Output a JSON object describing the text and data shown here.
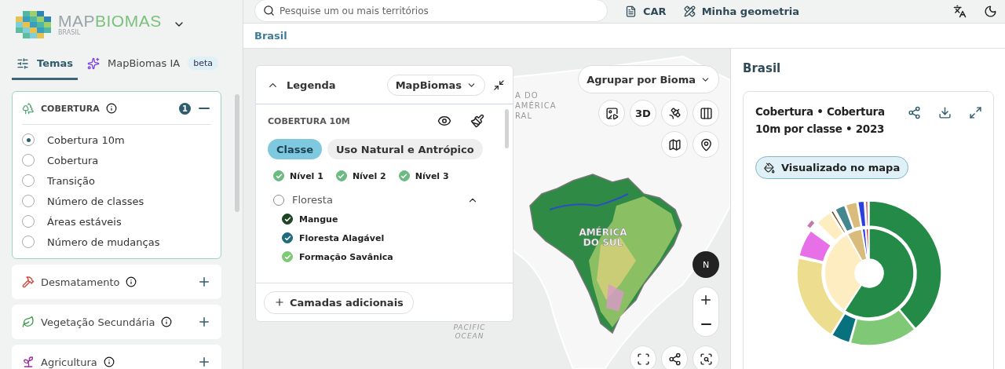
{
  "logo": {
    "text_1": "MAP",
    "text_2": "BIOMAS",
    "subtitle": "BRASIL"
  },
  "sidebar_tabs": [
    {
      "label": "Temas",
      "selected": true
    },
    {
      "label": "MapBiomas IA",
      "selected": false,
      "badge": "beta"
    }
  ],
  "themes": [
    {
      "title": "COBERTURA",
      "expanded": true,
      "count": "1",
      "color": "#5aa777",
      "options": [
        {
          "label": "Cobertura 10m",
          "selected": true
        },
        {
          "label": "Cobertura",
          "selected": false
        },
        {
          "label": "Transição",
          "selected": false
        },
        {
          "label": "Número de classes",
          "selected": false
        },
        {
          "label": "Áreas estáveis",
          "selected": false
        },
        {
          "label": "Número de mudanças",
          "selected": false
        }
      ]
    },
    {
      "title": "Desmatamento",
      "expanded": false,
      "color": "#d0453a"
    },
    {
      "title": "Vegetação Secundária",
      "expanded": false,
      "color": "#3c9a4a"
    },
    {
      "title": "Agricultura",
      "expanded": false,
      "color": "#9b2fa3"
    }
  ],
  "search": {
    "placeholder": "Pesquise um ou mais territórios"
  },
  "top_links": [
    "CAR",
    "Minha geometria"
  ],
  "breadcrumb": "Brasil",
  "legend": {
    "title": "Legenda",
    "expanded": true,
    "source": "MapBiomas",
    "section": "COBERTURA 10M",
    "modes": [
      {
        "label": "Classe",
        "selected": true
      },
      {
        "label": "Uso Natural e Antrópico",
        "selected": false
      }
    ],
    "levels": [
      {
        "label": "Nível 1",
        "checked": true
      },
      {
        "label": "Nível 2",
        "checked": true
      },
      {
        "label": "Nível 3",
        "checked": true
      }
    ],
    "group": {
      "label": "Floresta",
      "checked": false,
      "expanded": true,
      "children": [
        {
          "label": "Mangue",
          "checked": true,
          "color": "#1f4423"
        },
        {
          "label": "Floresta Alagável",
          "checked": true,
          "color": "#1e6b7e"
        },
        {
          "label": "Formação Savânica",
          "checked": true,
          "color": "#7dc975"
        }
      ]
    },
    "add_button": "Camadas adicionais"
  },
  "map": {
    "group_by": "Agrupar por Bioma",
    "view_3d": "3D",
    "compass": "N",
    "labels": [
      {
        "kind": "region",
        "text": "A DO"
      },
      {
        "kind": "region",
        "text": "AMÉRICA"
      },
      {
        "kind": "region",
        "text": "RAL"
      },
      {
        "kind": "continent",
        "text": "AMÉRICA DO SUL"
      },
      {
        "kind": "ocean",
        "text": "PACIFIC OCEAN"
      }
    ]
  },
  "panel": {
    "title": "Brasil",
    "card_title": "Cobertura • Cobertura 10m por classe • 2023",
    "chip": "Visualizado no mapa"
  }
}
